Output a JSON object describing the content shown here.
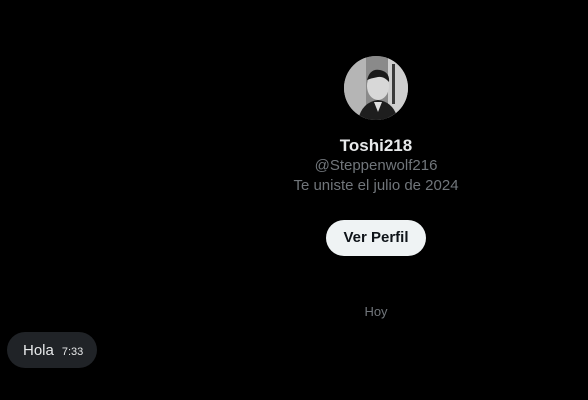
{
  "profile": {
    "display_name": "Toshi218",
    "handle": "@Steppenwolf216",
    "joined": "Te uniste el julio de 2024",
    "view_profile_label": "Ver Perfil"
  },
  "conversation": {
    "day_label": "Hoy",
    "messages": [
      {
        "text": "Hola",
        "time": "7:33"
      }
    ]
  },
  "colors": {
    "background": "#000000",
    "primary_text": "#e7e9ea",
    "secondary_text": "#71767b",
    "button_bg": "#eff3f4",
    "bubble_bg": "#202327"
  },
  "icons": {
    "avatar": "user-photo-avatar"
  }
}
